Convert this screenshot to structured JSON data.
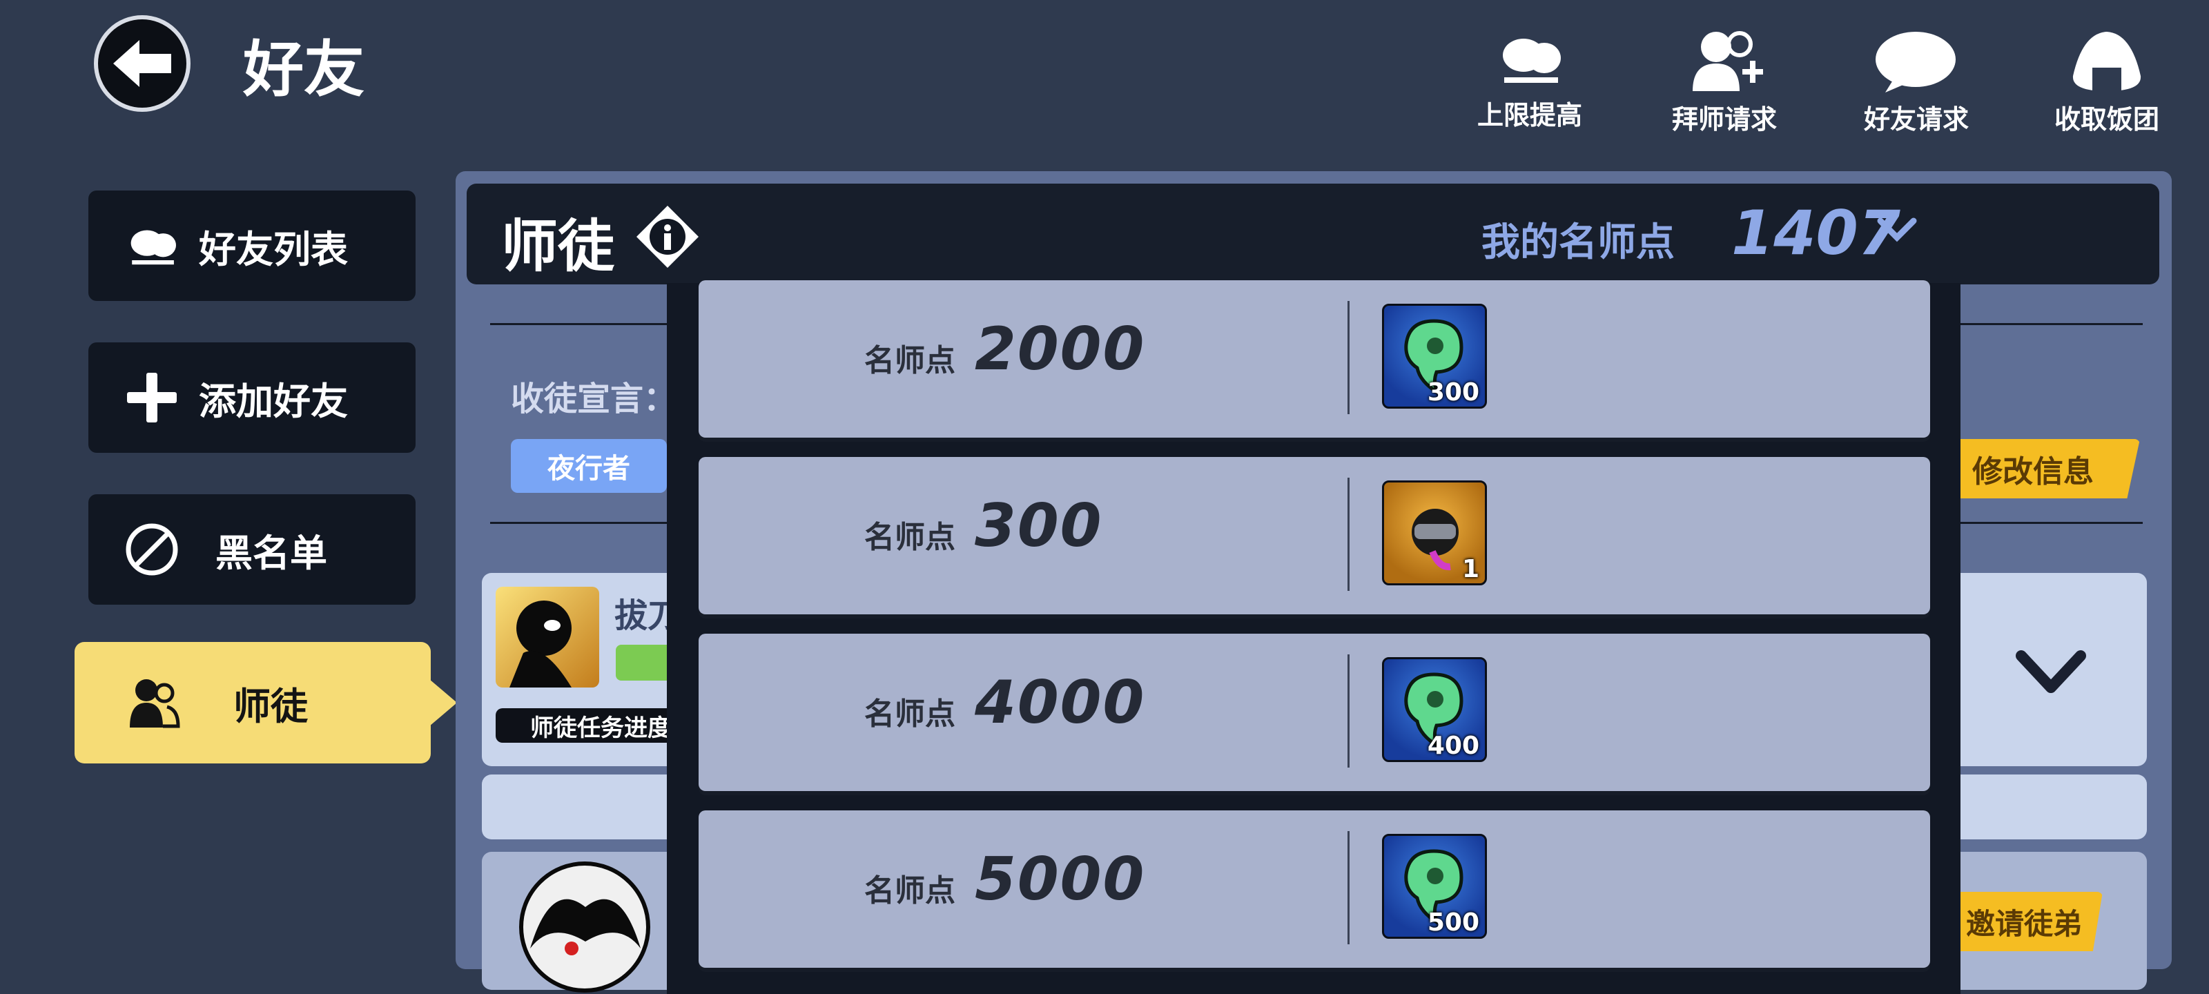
{
  "header": {
    "title": "好友",
    "actions": [
      {
        "label": "上限提高",
        "icon": "friends-icon"
      },
      {
        "label": "拜师请求",
        "icon": "add-mentor-icon"
      },
      {
        "label": "好友请求",
        "icon": "soap-bubble-icon"
      },
      {
        "label": "收取饭团",
        "icon": "rice-ball-icon"
      }
    ]
  },
  "sidebar": {
    "items": [
      {
        "label": "好友列表",
        "icon": "friends-icon"
      },
      {
        "label": "添加好友",
        "icon": "plus-icon"
      },
      {
        "label": "黑名单",
        "icon": "block-icon"
      },
      {
        "label": "师徒",
        "icon": "mentor-icon",
        "active": true
      }
    ]
  },
  "panel": {
    "title": "师徒",
    "points_label": "我的名师点",
    "points_value": "1407",
    "declaration_label": "收徒宣言：",
    "tag": "夜行者",
    "edit_button": "修改信息",
    "friend_name": "拔刀",
    "task_progress": "师徒任务进度",
    "invite_button": "邀请徒弟"
  },
  "dropdown": {
    "rows": [
      {
        "label": "名师点",
        "points": "2000",
        "reward_icon": "green-soul-icon",
        "reward_qty": "300",
        "color": "blue"
      },
      {
        "label": "名师点",
        "points": "300",
        "reward_icon": "ninja-head-icon",
        "reward_qty": "1",
        "color": "gold"
      },
      {
        "label": "名师点",
        "points": "4000",
        "reward_icon": "green-soul-icon",
        "reward_qty": "400",
        "color": "blue"
      },
      {
        "label": "名师点",
        "points": "5000",
        "reward_icon": "green-soul-icon",
        "reward_qty": "500",
        "color": "blue"
      }
    ]
  },
  "colors": {
    "background": "#2f3a4f",
    "active_tab": "#f6dc76",
    "accent_text": "#8ea8e6",
    "button_gold": "#f5bd22"
  }
}
